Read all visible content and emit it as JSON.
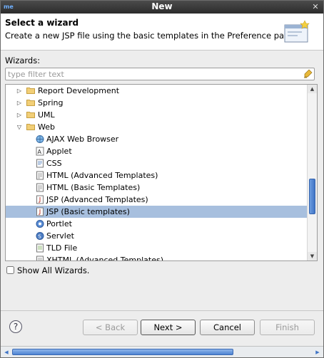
{
  "window": {
    "title": "New"
  },
  "header": {
    "title": "Select a wizard",
    "description": "Create a new JSP file using the basic templates in the Preference pages"
  },
  "wizards": {
    "label": "Wizards:",
    "filter_placeholder": "type filter text",
    "tree": [
      {
        "label": "Report Development",
        "type": "folder",
        "expanded": false,
        "depth": 0
      },
      {
        "label": "Spring",
        "type": "folder",
        "expanded": false,
        "depth": 0
      },
      {
        "label": "UML",
        "type": "folder",
        "expanded": false,
        "depth": 0
      },
      {
        "label": "Web",
        "type": "folder",
        "expanded": true,
        "depth": 0
      },
      {
        "label": "AJAX Web Browser",
        "type": "item",
        "icon": "globe-icon",
        "depth": 1
      },
      {
        "label": "Applet",
        "type": "item",
        "icon": "applet-icon",
        "depth": 1
      },
      {
        "label": "CSS",
        "type": "item",
        "icon": "css-file-icon",
        "depth": 1
      },
      {
        "label": "HTML (Advanced Templates)",
        "type": "item",
        "icon": "html-file-icon",
        "depth": 1
      },
      {
        "label": "HTML (Basic Templates)",
        "type": "item",
        "icon": "html-file-icon",
        "depth": 1
      },
      {
        "label": "JSP (Advanced Templates)",
        "type": "item",
        "icon": "jsp-file-icon",
        "depth": 1
      },
      {
        "label": "JSP (Basic templates)",
        "type": "item",
        "icon": "jsp-file-icon",
        "depth": 1,
        "selected": true
      },
      {
        "label": "Portlet",
        "type": "item",
        "icon": "portlet-icon",
        "depth": 1
      },
      {
        "label": "Servlet",
        "type": "item",
        "icon": "servlet-icon",
        "depth": 1
      },
      {
        "label": "TLD File",
        "type": "item",
        "icon": "tld-file-icon",
        "depth": 1
      },
      {
        "label": "XHTML (Advanced Templates)",
        "type": "item",
        "icon": "html-file-icon",
        "depth": 1
      }
    ]
  },
  "options": {
    "show_all_label": "Show All Wizards."
  },
  "buttons": {
    "back": "< Back",
    "next": "Next >",
    "cancel": "Cancel",
    "finish": "Finish"
  },
  "colors": {
    "selection": "#a7bfde",
    "titlebar": "#3a3a3a",
    "scroll_accent": "#3f74c6"
  }
}
